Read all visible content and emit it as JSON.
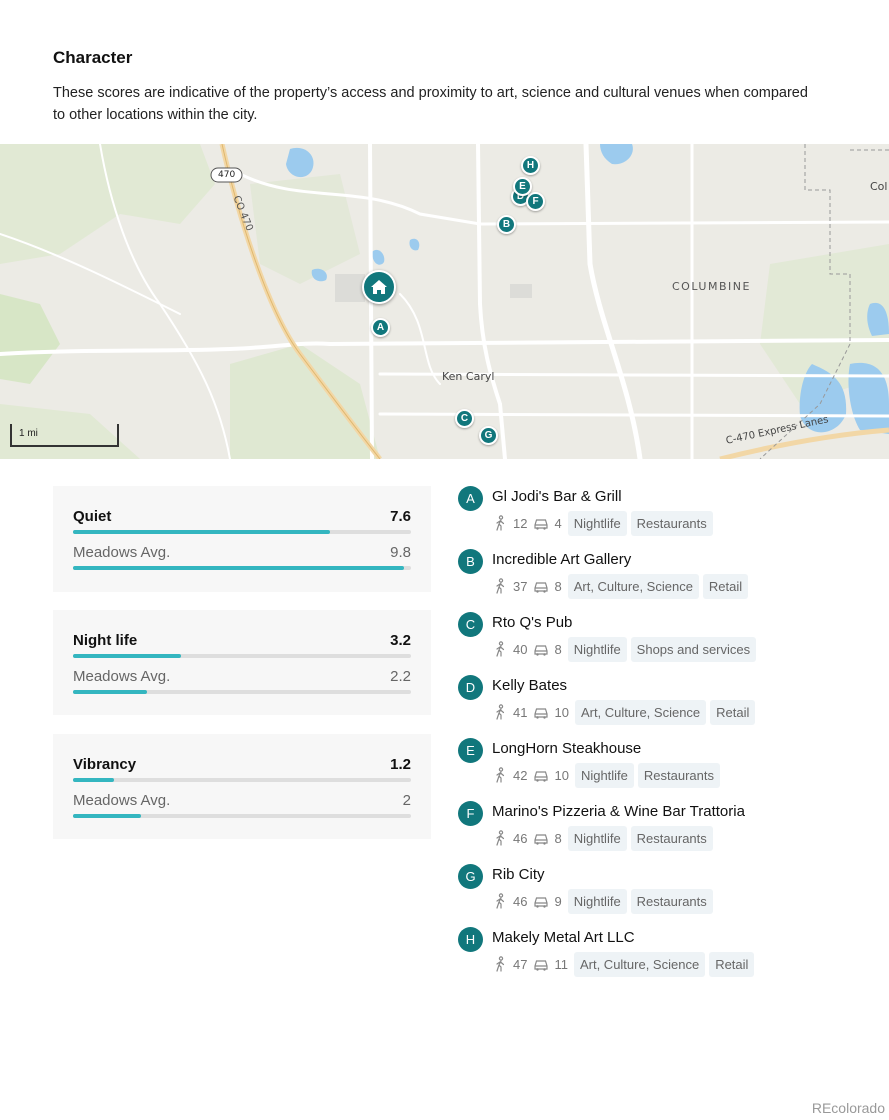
{
  "section": {
    "title": "Character",
    "description": "These scores are indicative of the property’s access and proximity to art, science and cultural venues when compared to other locations within the city."
  },
  "map": {
    "scale_label": "1 mi",
    "labels": {
      "highway_shield": "470",
      "highway_road": "CO 470",
      "area_columbine": "COLUMBINE",
      "area_kencaryl": "Ken Caryl",
      "express_lanes": "C-470 Express Lanes",
      "edge_text": "Col"
    },
    "pins": [
      "A",
      "B",
      "C",
      "D",
      "E",
      "F",
      "G",
      "H"
    ],
    "home_icon": "home-icon"
  },
  "scores": [
    {
      "label": "Quiet",
      "value": "7.6",
      "fill": 0.76,
      "avg_label": "Meadows Avg.",
      "avg_value": "9.8",
      "avg_fill": 0.98
    },
    {
      "label": "Night life",
      "value": "3.2",
      "fill": 0.32,
      "avg_label": "Meadows Avg.",
      "avg_value": "2.2",
      "avg_fill": 0.22
    },
    {
      "label": "Vibrancy",
      "value": "1.2",
      "fill": 0.12,
      "avg_label": "Meadows Avg.",
      "avg_value": "2",
      "avg_fill": 0.2
    }
  ],
  "places": [
    {
      "letter": "A",
      "name": "Gl Jodi's Bar & Grill",
      "walk": "12",
      "drive": "4",
      "tags": [
        "Nightlife",
        "Restaurants"
      ]
    },
    {
      "letter": "B",
      "name": "Incredible Art Gallery",
      "walk": "37",
      "drive": "8",
      "tags": [
        "Art, Culture, Science",
        "Retail"
      ]
    },
    {
      "letter": "C",
      "name": "Rto Q's Pub",
      "walk": "40",
      "drive": "8",
      "tags": [
        "Nightlife",
        "Shops and services"
      ]
    },
    {
      "letter": "D",
      "name": "Kelly Bates",
      "walk": "41",
      "drive": "10",
      "tags": [
        "Art, Culture, Science",
        "Retail"
      ]
    },
    {
      "letter": "E",
      "name": "LongHorn Steakhouse",
      "walk": "42",
      "drive": "10",
      "tags": [
        "Nightlife",
        "Restaurants"
      ]
    },
    {
      "letter": "F",
      "name": "Marino's Pizzeria & Wine Bar Trattoria",
      "walk": "46",
      "drive": "8",
      "tags": [
        "Nightlife",
        "Restaurants"
      ]
    },
    {
      "letter": "G",
      "name": "Rib City",
      "walk": "46",
      "drive": "9",
      "tags": [
        "Nightlife",
        "Restaurants"
      ]
    },
    {
      "letter": "H",
      "name": "Makely Metal Art LLC",
      "walk": "47",
      "drive": "11",
      "tags": [
        "Art, Culture, Science",
        "Retail"
      ]
    }
  ],
  "icons": {
    "walk": "walking-person-icon",
    "drive": "car-icon"
  },
  "colors": {
    "accent": "#11777c",
    "bar": "#34b6c0",
    "track": "#dedede",
    "card": "#f7f7f7",
    "tag_bg": "#eef3f6"
  },
  "footer": {
    "brand": "REcolorado"
  }
}
